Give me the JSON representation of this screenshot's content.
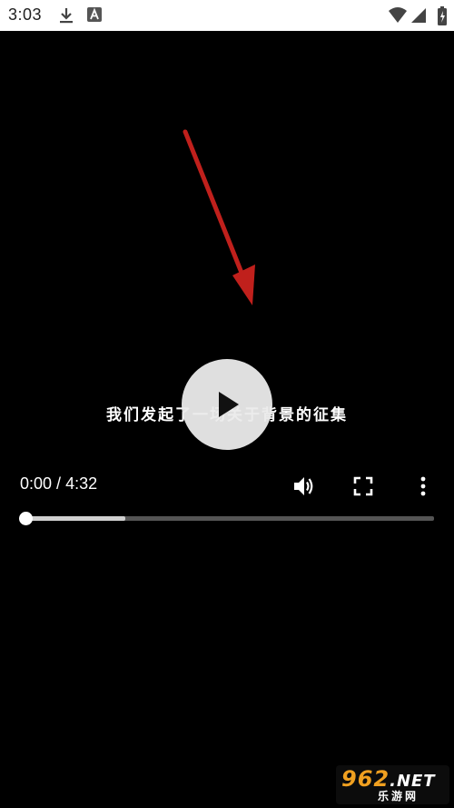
{
  "status_bar": {
    "time": "3:03",
    "icons": [
      "download-icon",
      "text-a-icon",
      "wifi-icon",
      "signal-icon",
      "battery-icon"
    ]
  },
  "video": {
    "subtitle": "我们发起了一场关于背景的征集",
    "current_time": "0:00",
    "separator": " / ",
    "duration": "4:32",
    "progress_fraction": 0.0,
    "buffered_fraction": 0.245,
    "controls": [
      "volume-icon",
      "fullscreen-icon",
      "more-options-icon"
    ]
  },
  "annotation": {
    "arrow_color": "#c0201c"
  },
  "watermark": {
    "main": "962",
    "net": ".NET",
    "sub": "乐游网"
  }
}
